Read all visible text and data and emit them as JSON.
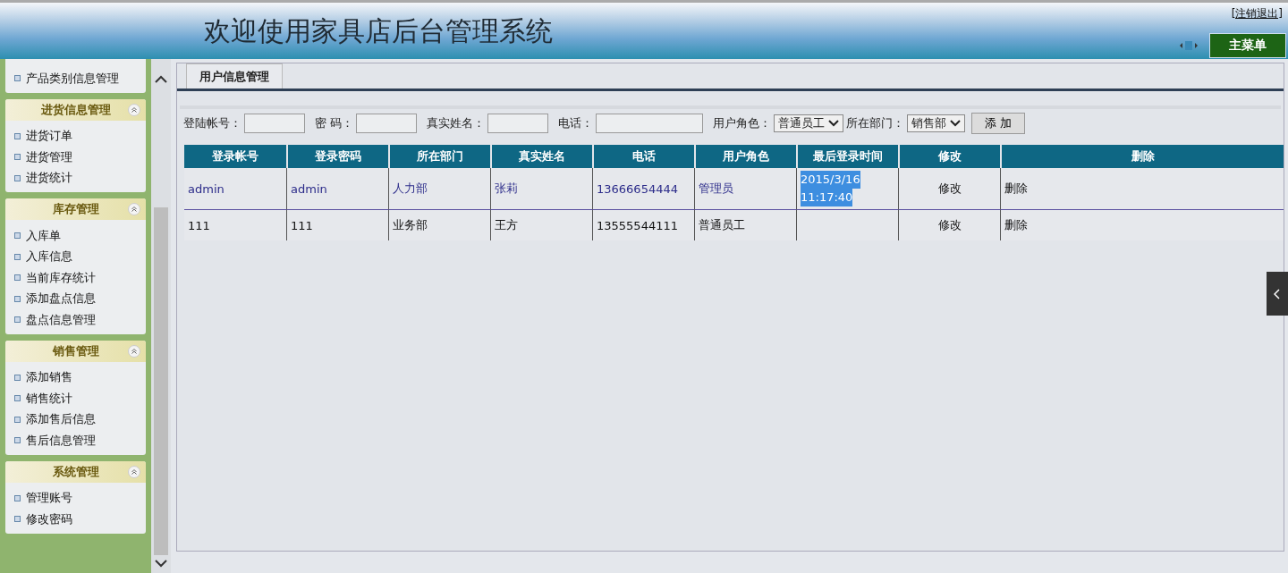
{
  "header": {
    "title": "欢迎使用家具店后台管理系统",
    "logout": "[注销退出]",
    "main_menu": "主菜单"
  },
  "sidebar": {
    "groups": [
      {
        "items": [
          "产品类别信息管理"
        ]
      },
      {
        "title": "进货信息管理",
        "items": [
          "进货订单",
          "进货管理",
          "进货统计"
        ]
      },
      {
        "title": "库存管理",
        "items": [
          "入库单",
          "入库信息",
          "当前库存统计",
          "添加盘点信息",
          "盘点信息管理"
        ]
      },
      {
        "title": "销售管理",
        "items": [
          "添加销售",
          "销售统计",
          "添加售后信息",
          "售后信息管理"
        ]
      },
      {
        "title": "系统管理",
        "items": [
          "管理账号",
          "修改密码"
        ]
      }
    ]
  },
  "tabs": [
    {
      "label": "用户信息管理"
    }
  ],
  "form": {
    "fields": [
      {
        "kind": "text",
        "label": "登陆帐号："
      },
      {
        "kind": "text",
        "label": "密 码："
      },
      {
        "kind": "text",
        "label": "真实姓名："
      },
      {
        "kind": "text",
        "label": "电话：",
        "wide": true
      },
      {
        "kind": "select",
        "label": "用户角色：",
        "value": "普通员工"
      },
      {
        "kind": "select",
        "label": "所在部门：",
        "value": "销售部"
      }
    ],
    "button": "添 加"
  },
  "table": {
    "columns": [
      "登录帐号",
      "登录密码",
      "所在部门",
      "真实姓名",
      "电话",
      "用户角色",
      "最后登录时间",
      "修改",
      "删除"
    ],
    "rows": [
      {
        "selected": true,
        "cells": [
          "admin",
          "admin",
          "人力部",
          "张莉",
          "13666654444",
          "管理员",
          [
            "2015/3/16",
            "11:17:40"
          ],
          "修改",
          "删除"
        ]
      },
      {
        "selected": false,
        "cells": [
          "111",
          "111",
          "业务部",
          "王方",
          "13555544111",
          "普通员工",
          [],
          "修改",
          "删除"
        ]
      }
    ]
  }
}
